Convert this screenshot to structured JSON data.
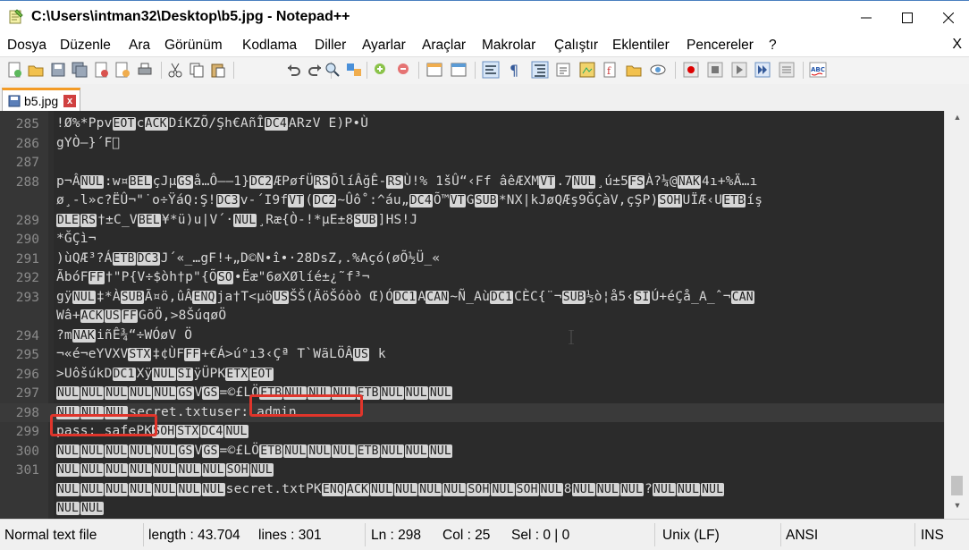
{
  "window": {
    "title": "C:\\Users\\intman32\\Desktop\\b5.jpg - Notepad++",
    "app_icon": "notepadpp-icon"
  },
  "menu": {
    "items": [
      "Dosya",
      "Düzenle",
      "Ara",
      "Görünüm",
      "Kodlama",
      "Diller",
      "Ayarlar",
      "Araçlar",
      "Makrolar",
      "Çalıştır",
      "Eklentiler",
      "Pencereler",
      "?"
    ],
    "close": "X"
  },
  "tab": {
    "label": "b5.jpg",
    "close": "x"
  },
  "editor": {
    "lines": [
      {
        "n": "285",
        "segs": [
          [
            "t",
            "!Ø%*Ppv"
          ],
          [
            "c",
            "EOT"
          ],
          [
            "t",
            "c"
          ],
          [
            "c",
            "ACK"
          ],
          [
            "t",
            "DíKZÕ/Şh€AñÎ"
          ],
          [
            "c",
            "DC4"
          ],
          [
            "t",
            "ARzV E)P•Ù"
          ]
        ]
      },
      {
        "n": "286",
        "segs": [
          [
            "t",
            "gYÒ—}´F⃞"
          ]
        ]
      },
      {
        "n": "287",
        "segs": [
          [
            "t",
            ""
          ]
        ]
      },
      {
        "n": "288",
        "segs": [
          [
            "t",
            "p¬Â"
          ],
          [
            "c",
            "NUL"
          ],
          [
            "t",
            ":w¤"
          ],
          [
            "c",
            "BEL"
          ],
          [
            "t",
            "çJµ"
          ],
          [
            "c",
            "GS"
          ],
          [
            "t",
            "å…Ô——1}"
          ],
          [
            "c",
            "DC2"
          ],
          [
            "t",
            "ÆPøfÜ"
          ],
          [
            "c",
            "RS"
          ],
          [
            "t",
            "ÕlíÂğÊ-"
          ],
          [
            "c",
            "RS"
          ],
          [
            "t",
            "Ù!% 1šÛ“‹Ff âêÆXM"
          ],
          [
            "c",
            "VT"
          ],
          [
            "t",
            ".7"
          ],
          [
            "c",
            "NUL"
          ],
          [
            "t",
            "¸ú±5"
          ],
          [
            "c",
            "FS"
          ],
          [
            "t",
            "À?¼@"
          ],
          [
            "c",
            "NAK"
          ],
          [
            "t",
            "4ı+%Ä…ı"
          ]
        ]
      },
      {
        "n": "",
        "segs": [
          [
            "t",
            "ø¸-l»c?ËÛ¬\"˙o÷ŸáQ:Ş!"
          ],
          [
            "c",
            "DC3"
          ],
          [
            "t",
            "v-´I9f"
          ],
          [
            "c",
            "VT"
          ],
          [
            "t",
            "("
          ],
          [
            "c",
            "DC2"
          ],
          [
            "t",
            "~Ûô˚:^áu„"
          ],
          [
            "c",
            "DC4"
          ],
          [
            "t",
            "Õ™"
          ],
          [
            "c",
            "VT"
          ],
          [
            "t",
            "G"
          ],
          [
            "c",
            "SUB"
          ],
          [
            "t",
            "*NX|kJøQÆş9ĞÇàV,çŞP)"
          ],
          [
            "c",
            "SOH"
          ],
          [
            "t",
            "UÏÆ‹U"
          ],
          [
            "c",
            "ETB"
          ],
          [
            "t",
            "íş"
          ]
        ]
      },
      {
        "n": "289",
        "segs": [
          [
            "c",
            "DLE"
          ],
          [
            "c",
            "RS"
          ],
          [
            "t",
            "†±C_V"
          ],
          [
            "c",
            "BEL"
          ],
          [
            "t",
            "¥*ü)u|V´·"
          ],
          [
            "c",
            "NUL"
          ],
          [
            "t",
            "¸Ræ{Ò-!*µE±8"
          ],
          [
            "c",
            "SUB"
          ],
          [
            "t",
            "]HS!J"
          ]
        ]
      },
      {
        "n": "290",
        "segs": [
          [
            "t",
            "*ĞÇì¬"
          ]
        ]
      },
      {
        "n": "291",
        "segs": [
          [
            "t",
            ")ùQÆ³?Á"
          ],
          [
            "c",
            "ETB"
          ],
          [
            "c",
            "DC3"
          ],
          [
            "t",
            "J´«_…gF!+„D©N•î•·28DsZ,.%Açó(øÕ½Ü_«"
          ]
        ]
      },
      {
        "n": "292",
        "segs": [
          [
            "t",
            "ÃbóF"
          ],
          [
            "c",
            "FF"
          ],
          [
            "t",
            "†\"P{V÷$òh†p\"{Õ"
          ],
          [
            "c",
            "SO"
          ],
          [
            "t",
            "•Ëæ\"6øXØlíé±¿˜f³¬"
          ]
        ]
      },
      {
        "n": "293",
        "segs": [
          [
            "t",
            "gÿ"
          ],
          [
            "c",
            "NUL"
          ],
          [
            "t",
            "‡*À"
          ],
          [
            "c",
            "SUB"
          ],
          [
            "t",
            "Ã¤ö,ûÂ"
          ],
          [
            "c",
            "ENQ"
          ],
          [
            "t",
            "ja†T<µö"
          ],
          [
            "c",
            "US"
          ],
          [
            "t",
            "ŠŠ(ÄöŠóòò Œ)Ó"
          ],
          [
            "c",
            "DC1"
          ],
          [
            "t",
            "A"
          ],
          [
            "c",
            "CAN"
          ],
          [
            "t",
            "~Ñ_Aù"
          ],
          [
            "c",
            "DC1"
          ],
          [
            "t",
            "CÈC{¨¬"
          ],
          [
            "c",
            "SUB"
          ],
          [
            "t",
            "½ò¦å5‹"
          ],
          [
            "c",
            "SI"
          ],
          [
            "t",
            "Ú+éÇå_A_ˆ¬"
          ],
          [
            "c",
            "CAN"
          ]
        ]
      },
      {
        "n": "",
        "segs": [
          [
            "t",
            "Wâ+"
          ],
          [
            "c",
            "ACK"
          ],
          [
            "c",
            "US"
          ],
          [
            "c",
            "FF"
          ],
          [
            "t",
            "GõÖ,>8ŠúqøÖ"
          ]
        ]
      },
      {
        "n": "294",
        "segs": [
          [
            "t",
            "?m"
          ],
          [
            "c",
            "NAK"
          ],
          [
            "t",
            "iñÊ¾“÷WÓøV Ö"
          ]
        ]
      },
      {
        "n": "295",
        "segs": [
          [
            "t",
            "¬«é¬eYVXV"
          ],
          [
            "c",
            "STX"
          ],
          [
            "t",
            "‡¢ÙF"
          ],
          [
            "c",
            "FF"
          ],
          [
            "t",
            "+€Á>ú°ı3‹Çª T`WãLÖÂ"
          ],
          [
            "c",
            "US"
          ],
          [
            "t",
            " k"
          ]
        ]
      },
      {
        "n": "296",
        "segs": [
          [
            "t",
            ">UôšúkD"
          ],
          [
            "c",
            "DC1"
          ],
          [
            "t",
            "Xÿ"
          ],
          [
            "c",
            "NUL"
          ],
          [
            "c",
            "SI"
          ],
          [
            "t",
            "ÿÜPK"
          ],
          [
            "c",
            "ETX"
          ],
          [
            "c",
            "EOT"
          ]
        ]
      },
      {
        "n": "297",
        "segs": [
          [
            "c",
            "NUL"
          ],
          [
            "c",
            "NUL"
          ],
          [
            "c",
            "NUL"
          ],
          [
            "c",
            "NUL"
          ],
          [
            "c",
            "NUL"
          ],
          [
            "c",
            "GS"
          ],
          [
            "t",
            "V"
          ],
          [
            "c",
            "GS"
          ],
          [
            "t",
            "=©£LÖ"
          ],
          [
            "c",
            "ETB"
          ],
          [
            "c",
            "NUL"
          ],
          [
            "c",
            "NUL"
          ],
          [
            "c",
            "NUL"
          ],
          [
            "c",
            "ETB"
          ],
          [
            "c",
            "NUL"
          ],
          [
            "c",
            "NUL"
          ],
          [
            "c",
            "NUL"
          ]
        ]
      },
      {
        "n": "298",
        "segs": [
          [
            "c",
            "NUL"
          ],
          [
            "c",
            "NUL"
          ],
          [
            "c",
            "NUL"
          ],
          [
            "t",
            "secret.txt"
          ],
          [
            "t",
            "user: admin"
          ]
        ],
        "current": true
      },
      {
        "n": "299",
        "segs": [
          [
            "t",
            "pass: safe"
          ],
          [
            "t",
            "PK"
          ],
          [
            "c",
            "SOH"
          ],
          [
            "c",
            "STX"
          ],
          [
            "c",
            "DC4"
          ],
          [
            "c",
            "NUL"
          ]
        ]
      },
      {
        "n": "300",
        "segs": [
          [
            "c",
            "NUL"
          ],
          [
            "c",
            "NUL"
          ],
          [
            "c",
            "NUL"
          ],
          [
            "c",
            "NUL"
          ],
          [
            "c",
            "NUL"
          ],
          [
            "c",
            "GS"
          ],
          [
            "t",
            "V"
          ],
          [
            "c",
            "GS"
          ],
          [
            "t",
            "=©£LÖ"
          ],
          [
            "c",
            "ETB"
          ],
          [
            "c",
            "NUL"
          ],
          [
            "c",
            "NUL"
          ],
          [
            "c",
            "NUL"
          ],
          [
            "c",
            "ETB"
          ],
          [
            "c",
            "NUL"
          ],
          [
            "c",
            "NUL"
          ],
          [
            "c",
            "NUL"
          ]
        ]
      },
      {
        "n": "301",
        "segs": [
          [
            "c",
            "NUL"
          ],
          [
            "c",
            "NUL"
          ],
          [
            "c",
            "NUL"
          ],
          [
            "c",
            "NUL"
          ],
          [
            "c",
            "NUL"
          ],
          [
            "c",
            "NUL"
          ],
          [
            "c",
            "NUL"
          ],
          [
            "c",
            "SOH"
          ],
          [
            "c",
            "NUL"
          ]
        ]
      },
      {
        "n": "",
        "segs": [
          [
            "c",
            "NUL"
          ],
          [
            "c",
            "NUL"
          ],
          [
            "c",
            "NUL"
          ],
          [
            "c",
            "NUL"
          ],
          [
            "c",
            "NUL"
          ],
          [
            "c",
            "NUL"
          ],
          [
            "c",
            "NUL"
          ],
          [
            "t",
            "secret.txtPK"
          ],
          [
            "c",
            "ENQ"
          ],
          [
            "c",
            "ACK"
          ],
          [
            "c",
            "NUL"
          ],
          [
            "c",
            "NUL"
          ],
          [
            "c",
            "NUL"
          ],
          [
            "c",
            "NUL"
          ],
          [
            "c",
            "SOH"
          ],
          [
            "c",
            "NUL"
          ],
          [
            "c",
            "SOH"
          ],
          [
            "c",
            "NUL"
          ],
          [
            "t",
            "8"
          ],
          [
            "c",
            "NUL"
          ],
          [
            "c",
            "NUL"
          ],
          [
            "c",
            "NUL"
          ],
          [
            "t",
            "?"
          ],
          [
            "c",
            "NUL"
          ],
          [
            "c",
            "NUL"
          ],
          [
            "c",
            "NUL"
          ]
        ]
      },
      {
        "n": "",
        "segs": [
          [
            "c",
            "NUL"
          ],
          [
            "c",
            "NUL"
          ]
        ]
      }
    ]
  },
  "status": {
    "file_type": "Normal text file",
    "length": "length : 43.704",
    "lines": "lines : 301",
    "ln": "Ln : 298",
    "col": "Col : 25",
    "sel": "Sel : 0 | 0",
    "eol": "Unix (LF)",
    "encoding": "ANSI",
    "mode": "INS"
  },
  "colors": {
    "editor_bg": "#2b2b2b",
    "highlight_box": "#e0352b",
    "control_char_bg": "#d6d6d6"
  }
}
